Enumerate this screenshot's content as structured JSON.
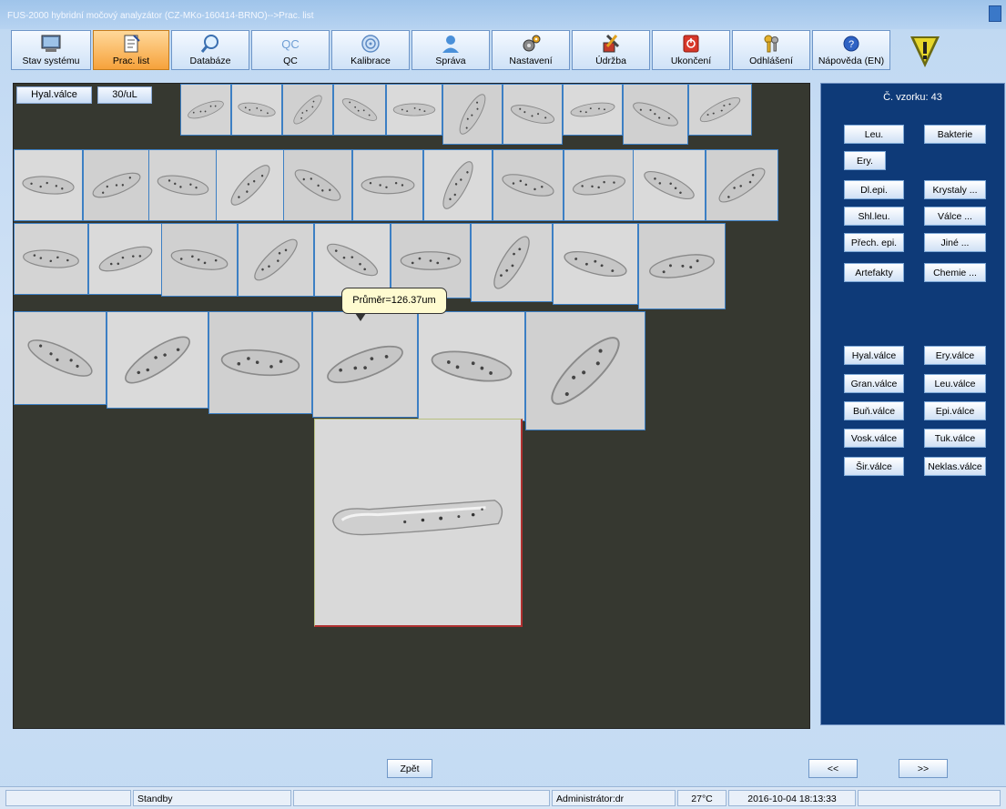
{
  "window": {
    "title": "FUS-2000 hybridní močový analyzátor (CZ-MKo-160414-BRNO)-->Prac. list"
  },
  "toolbar": [
    {
      "id": "stav",
      "label": "Stav systému",
      "icon": "monitor-icon"
    },
    {
      "id": "prac",
      "label": "Prac. list",
      "icon": "worksheet-icon",
      "active": true
    },
    {
      "id": "databaze",
      "label": "Databáze",
      "icon": "magnifier-icon"
    },
    {
      "id": "qc",
      "label": "QC",
      "icon": "qc-icon"
    },
    {
      "id": "kalibrace",
      "label": "Kalibrace",
      "icon": "target-icon"
    },
    {
      "id": "sprava",
      "label": "Správa",
      "icon": "user-icon"
    },
    {
      "id": "nastaveni",
      "label": "Nastavení",
      "icon": "gears-icon"
    },
    {
      "id": "udrzba",
      "label": "Údržba",
      "icon": "tools-icon"
    },
    {
      "id": "ukonceni",
      "label": "Ukončení",
      "icon": "power-icon"
    },
    {
      "id": "odhlaseni",
      "label": "Odhlášení",
      "icon": "keys-icon"
    },
    {
      "id": "napoveda",
      "label": "Nápověda (EN)",
      "icon": "help-icon"
    }
  ],
  "viewer": {
    "category_tag": "Hyal.válce",
    "count_tag": "30/uL",
    "tooltip": "Průměr=126.37um"
  },
  "panel": {
    "sample_label": "Č. vzorku: 43",
    "buttons": [
      "Leu.",
      "Bakterie",
      "Ery.",
      "Dl.epi.",
      "Krystaly ...",
      "Shl.leu.",
      "Válce ...",
      "Přech. epi.",
      "Jiné ...",
      "Artefakty",
      "Chemie ..."
    ],
    "cast_buttons": [
      "Hyal.válce",
      "Ery.válce",
      "Gran.válce",
      "Leu.válce",
      "Buň.válce",
      "Epi.válce",
      "Vosk.válce",
      "Tuk.válce",
      "Šir.válce",
      "Neklas.válce"
    ]
  },
  "bottom": {
    "back_label": "Zpět",
    "prev_label": "<<",
    "next_label": ">>"
  },
  "status": {
    "left": "",
    "state": "Standby",
    "middle": "",
    "user": "Administrátor:dr",
    "temperature": "27°C",
    "datetime": "2016-10-04 18:13:33"
  }
}
